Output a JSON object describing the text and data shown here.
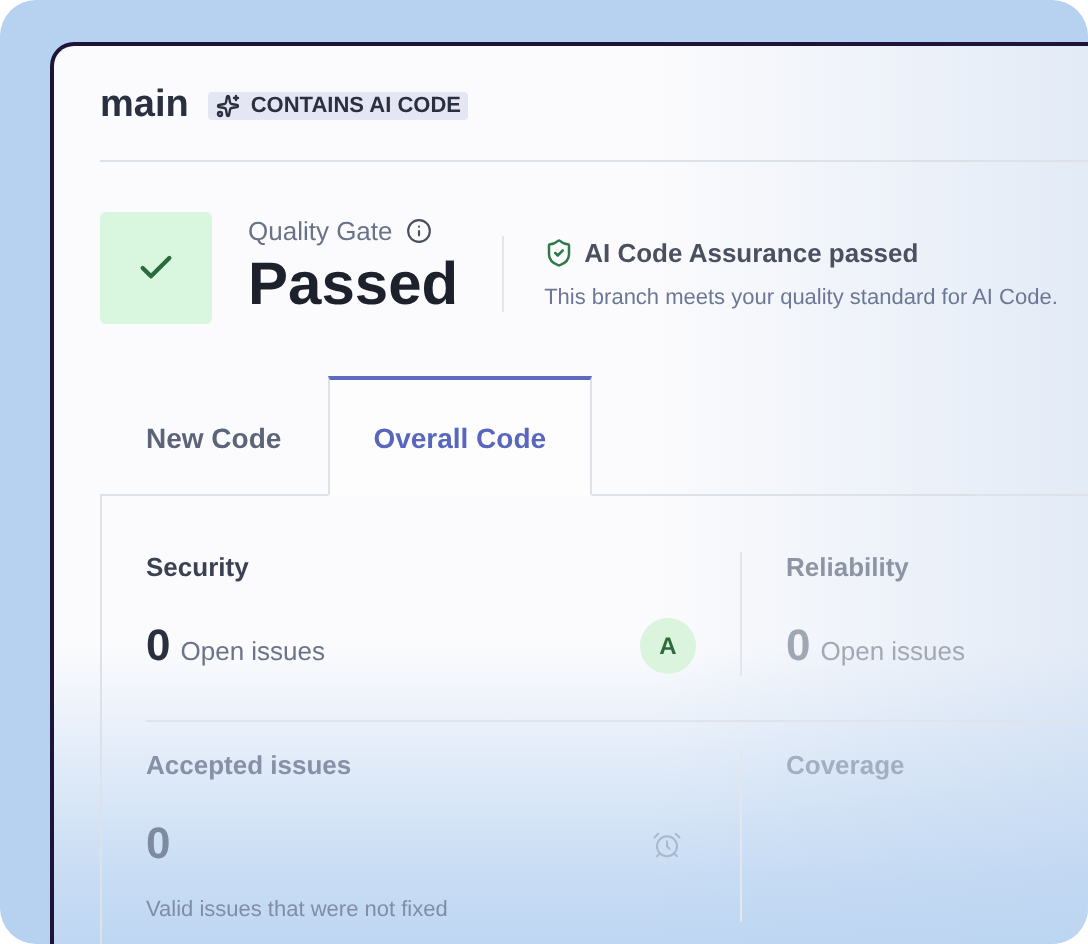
{
  "branch": {
    "name": "main",
    "badge": "CONTAINS AI CODE"
  },
  "quality_gate": {
    "label": "Quality Gate",
    "status": "Passed",
    "passed": true
  },
  "assurance": {
    "title": "AI Code Assurance passed",
    "description": "This branch meets your quality standard for AI Code."
  },
  "tabs": [
    {
      "label": "New Code",
      "selected": false
    },
    {
      "label": "Overall Code",
      "selected": true
    }
  ],
  "metrics": [
    {
      "kind": "rating",
      "title": "Security",
      "value": "0",
      "unit": "Open issues",
      "rating": "A"
    },
    {
      "kind": "plain",
      "title": "Reliability",
      "value": "0",
      "unit": "Open issues"
    },
    {
      "kind": "accepted",
      "title": "Accepted issues",
      "value": "0",
      "note": "Valid issues that were not fixed"
    },
    {
      "kind": "plain",
      "title": "Coverage"
    }
  ]
}
